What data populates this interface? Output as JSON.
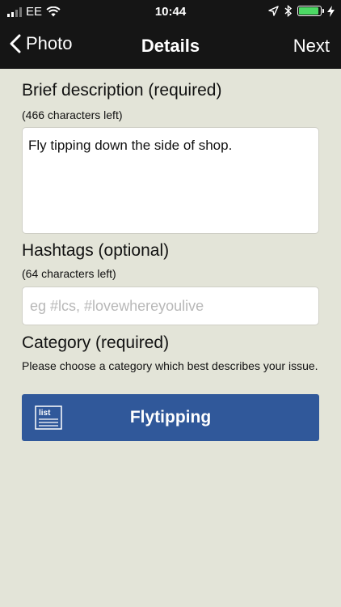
{
  "status_bar": {
    "carrier": "EE",
    "time": "10:44"
  },
  "nav": {
    "back_label": "Photo",
    "title": "Details",
    "next_label": "Next"
  },
  "form": {
    "description": {
      "heading": "Brief description (required)",
      "chars_left": "(466 characters left)",
      "value": "Fly tipping down the side of shop."
    },
    "hashtags": {
      "heading": "Hashtags (optional)",
      "chars_left": "(64 characters left)",
      "placeholder": "eg #lcs, #lovewhereyoulive"
    },
    "category": {
      "heading": "Category (required)",
      "instruction": "Please choose a category which best describes your issue.",
      "selected": "Flytipping",
      "icon_text": "list"
    }
  },
  "colors": {
    "background": "#e3e4d8",
    "header": "#151515",
    "button": "#30589a",
    "battery": "#4cd964"
  }
}
